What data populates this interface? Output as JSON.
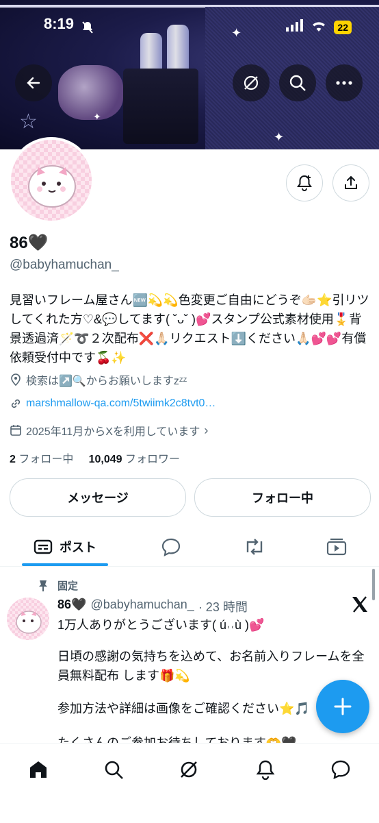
{
  "status_bar": {
    "time": "8:19",
    "battery": "22"
  },
  "profile": {
    "name": "86🖤",
    "handle": "@babyhamuchan_",
    "bio": "見習いフレーム屋さん🆕💫💫色変更ご自由にどうぞ🫱🏻⭐️引リツしてくれた方♡&💬してます( ˘ᴗ˘ )💕スタンプ公式素材使用🎖️背景透過済🪄➰２次配布❌🙏🏻リクエスト⬇️ください🙏🏻💕💕有償依頼受付中です🍒✨",
    "location": "検索は↗️🔍からお願いしますzᶻᶻ",
    "link": "marshmallow-qa.com/5twiimk2c8tvt0…",
    "joined": "2025年11月からXを利用しています",
    "following_count": "2",
    "following_label": "フォロー中",
    "followers_count": "10,049",
    "followers_label": "フォロワー"
  },
  "buttons": {
    "message": "メッセージ",
    "following": "フォロー中"
  },
  "tabs": {
    "posts": "ポスト"
  },
  "pinned_post": {
    "pinned_label": "固定",
    "name": "86🖤",
    "handle": "@babyhamuchan_",
    "time": "· 23 時間",
    "line1": "1万人ありがとうございます( ú˓˓ù )💕",
    "line2": "日頃の感謝の気持ちを込めて、お名前入りフレームを全員無料配布 します🎁💫",
    "line3": "参加方法や詳細は画像をご確認ください⭐️🎵",
    "line4": "たくさんのご参加お待ちしております🫶🖤"
  },
  "colors": {
    "accent": "#1d9bf0",
    "text": "#0f1419",
    "secondary": "#536471",
    "border": "#cfd9de"
  },
  "icons": [
    "back-arrow-icon",
    "grok-icon",
    "search-icon",
    "more-icon",
    "notify-bell-icon",
    "share-icon",
    "location-icon",
    "link-icon",
    "calendar-icon",
    "pin-icon",
    "x-logo-icon",
    "plus-icon",
    "home-icon",
    "message-icon"
  ]
}
